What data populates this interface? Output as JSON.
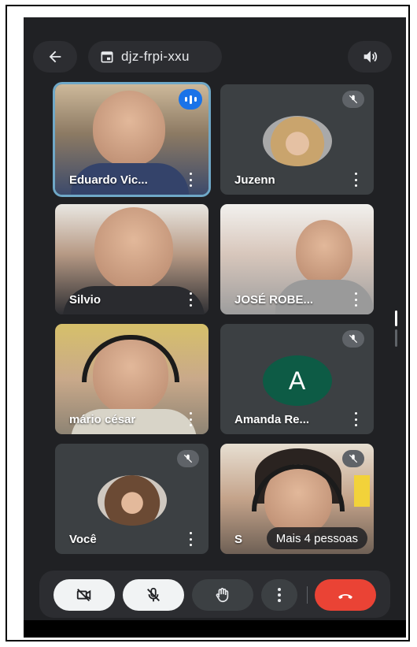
{
  "top_bar": {
    "back_icon": "arrow-left-icon",
    "meeting_code": "djz-frpi-xxu",
    "meeting_icon": "calendar-icon",
    "speaker_icon": "speaker-icon"
  },
  "participants": [
    {
      "name": "Eduardo Vic...",
      "speaking": true,
      "muted": false,
      "type": "video"
    },
    {
      "name": "Juzenn",
      "speaking": false,
      "muted": true,
      "type": "photo"
    },
    {
      "name": "Silvio",
      "speaking": false,
      "muted": false,
      "type": "video"
    },
    {
      "name": "JOSÉ ROBE...",
      "speaking": false,
      "muted": false,
      "type": "video"
    },
    {
      "name": "mário césar",
      "speaking": false,
      "muted": false,
      "type": "video"
    },
    {
      "name": "Amanda Re...",
      "speaking": false,
      "muted": true,
      "type": "letter",
      "letter": "A"
    },
    {
      "name": "Você",
      "speaking": false,
      "muted": true,
      "type": "photo"
    },
    {
      "name": "S",
      "speaking": false,
      "muted": true,
      "type": "video"
    }
  ],
  "more_people_label": "Mais 4 pessoas",
  "controls": {
    "camera_icon": "camera-off-icon",
    "mic_icon": "mic-off-icon",
    "hand_icon": "raise-hand-icon",
    "more_icon": "more-vert-icon",
    "end_call_icon": "end-call-icon"
  },
  "colors": {
    "background": "#202124",
    "tile": "#3c4043",
    "accent_speaking": "#1a73e8",
    "end_call": "#ea4335",
    "avatar_letter_bg": "#0d5b45"
  }
}
